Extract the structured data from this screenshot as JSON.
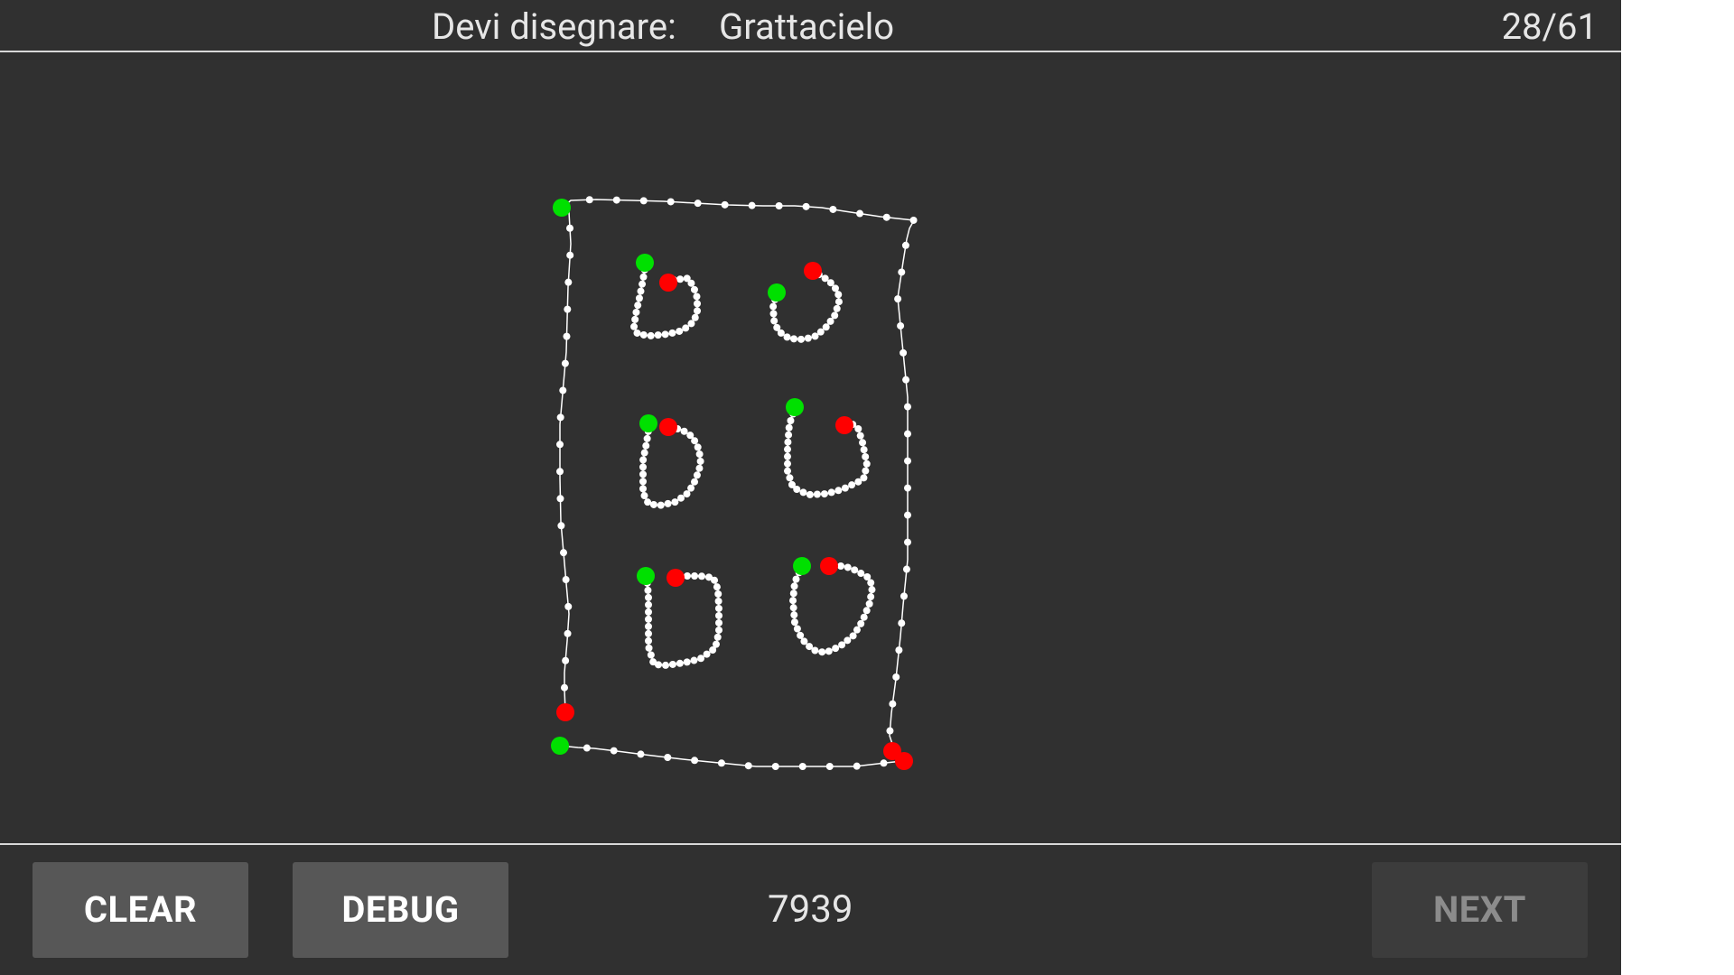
{
  "header": {
    "prompt_label": "Devi disegnare:",
    "prompt_word": "Grattacielo",
    "progress": "28/61"
  },
  "footer": {
    "clear_label": "CLEAR",
    "debug_label": "DEBUG",
    "score": "7939",
    "next_label": "NEXT"
  },
  "colors": {
    "background": "#303030",
    "stroke_point": "#ffffff",
    "stroke_start": "#00e000",
    "stroke_end": "#ff0000",
    "button_bg": "#575757",
    "button_disabled_bg": "#3c3c3c"
  }
}
